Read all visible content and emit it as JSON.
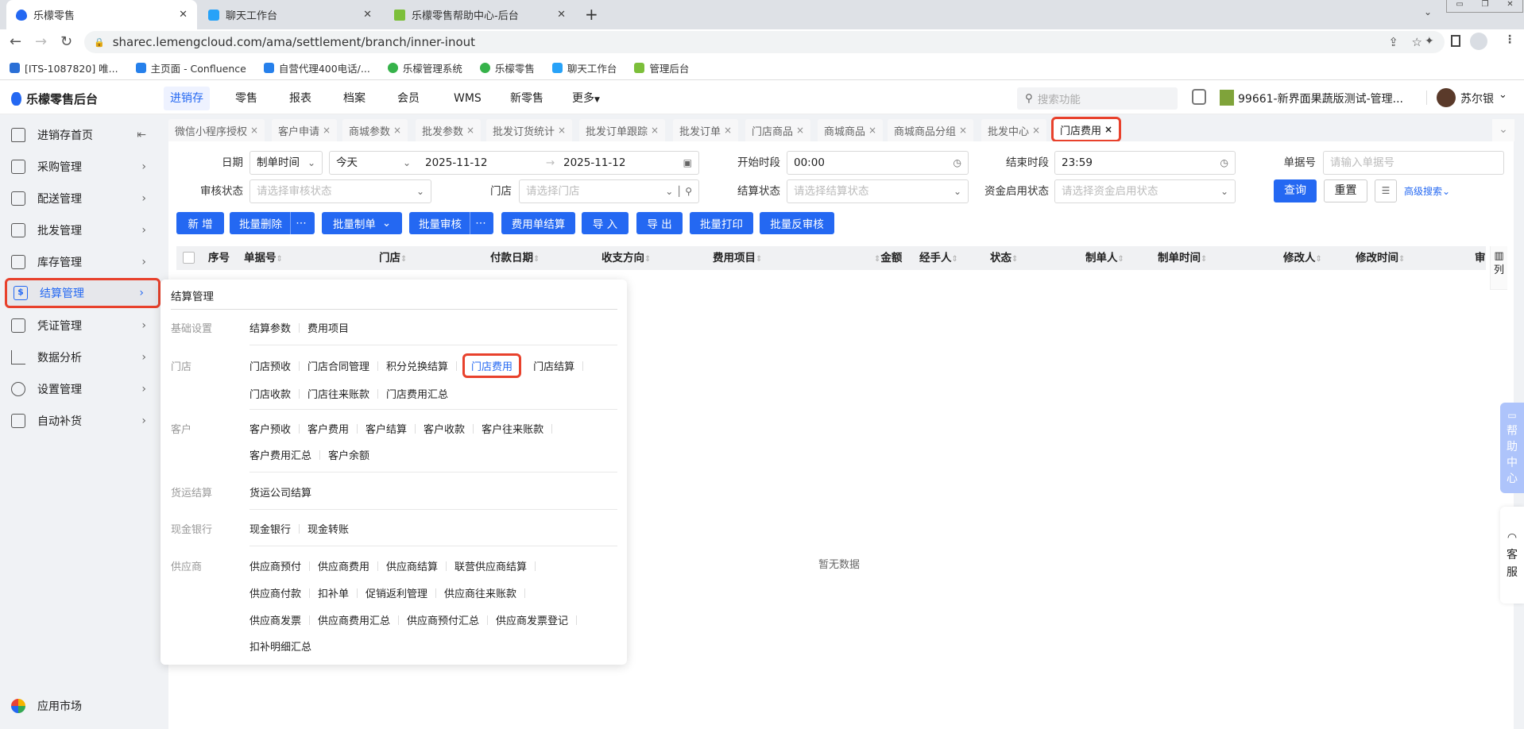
{
  "browser": {
    "tabs": [
      {
        "title": "乐檬零售",
        "active": true
      },
      {
        "title": "聊天工作台",
        "active": false
      },
      {
        "title": "乐檬零售帮助中心-后台",
        "active": false
      }
    ],
    "url": "sharec.lemengcloud.com/ama/settlement/branch/inner-inout",
    "bookmarks": [
      "[ITS-1087820] 唯...",
      "主页面 - Confluence",
      "自营代理400电话/...",
      "乐檬管理系统",
      "乐檬零售",
      "聊天工作台",
      "管理后台"
    ]
  },
  "header": {
    "logo": "乐檬零售后台",
    "nav": [
      "进销存",
      "零售",
      "报表",
      "档案",
      "会员",
      "WMS",
      "新零售",
      "更多"
    ],
    "search_placeholder": "搜索功能",
    "store": "99661-新界面果蔬版测试-管理...",
    "user": "苏尔银"
  },
  "sidebar": {
    "items": [
      "进销存首页",
      "采购管理",
      "配送管理",
      "批发管理",
      "库存管理",
      "结算管理",
      "凭证管理",
      "数据分析",
      "设置管理",
      "自动补货"
    ],
    "active": "结算管理",
    "footer": "应用市场"
  },
  "page_tabs": [
    "微信小程序授权",
    "客户申请",
    "商城参数",
    "批发参数",
    "批发订货统计",
    "批发订单跟踪",
    "批发订单",
    "门店商品",
    "商城商品",
    "商城商品分组",
    "批发中心",
    "门店费用"
  ],
  "filters": {
    "date_label": "日期",
    "date_type": "制单时间",
    "date_range": "今天",
    "date_start": "2025-11-12",
    "date_end": "2025-11-12",
    "start_time_label": "开始时段",
    "start_time": "00:00",
    "end_time_label": "结束时段",
    "end_time": "23:59",
    "doc_no_label": "单据号",
    "doc_no_placeholder": "请输入单据号",
    "audit_label": "审核状态",
    "audit_placeholder": "请选择审核状态",
    "store_label": "门店",
    "store_placeholder": "请选择门店",
    "settle_label": "结算状态",
    "settle_placeholder": "请选择结算状态",
    "fund_label": "资金启用状态",
    "fund_placeholder": "请选择资金启用状态",
    "query": "查询",
    "reset": "重置",
    "advanced": "高级搜索"
  },
  "actions": [
    "新 增",
    "批量删除",
    "批量制单",
    "批量审核",
    "费用单结算",
    "导 入",
    "导 出",
    "批量打印",
    "批量反审核"
  ],
  "table": {
    "columns": [
      "序号",
      "单据号",
      "门店",
      "付款日期",
      "收支方向",
      "费用项目",
      "金额",
      "经手人",
      "状态",
      "制单人",
      "制单时间",
      "修改人",
      "修改时间",
      "审"
    ],
    "column_setting": "列",
    "empty": "暂无数据"
  },
  "menu": {
    "title": "结算管理",
    "groups": [
      {
        "label": "基础设置",
        "rows": [
          [
            "结算参数",
            "费用项目"
          ]
        ]
      },
      {
        "label": "门店",
        "rows": [
          [
            "门店预收",
            "门店合同管理",
            "积分兑换结算",
            "门店费用",
            "门店结算"
          ],
          [
            "门店收款",
            "门店往来账款",
            "门店费用汇总"
          ]
        ]
      },
      {
        "label": "客户",
        "rows": [
          [
            "客户预收",
            "客户费用",
            "客户结算",
            "客户收款",
            "客户往来账款"
          ],
          [
            "客户费用汇总",
            "客户余额"
          ]
        ]
      },
      {
        "label": "货运结算",
        "rows": [
          [
            "货运公司结算"
          ]
        ]
      },
      {
        "label": "现金银行",
        "rows": [
          [
            "现金银行",
            "现金转账"
          ]
        ]
      },
      {
        "label": "供应商",
        "rows": [
          [
            "供应商预付",
            "供应商费用",
            "供应商结算",
            "联营供应商结算"
          ],
          [
            "供应商付款",
            "扣补单",
            "促销返利管理",
            "供应商往来账款"
          ],
          [
            "供应商发票",
            "供应商费用汇总",
            "供应商预付汇总",
            "供应商发票登记"
          ],
          [
            "扣补明细汇总"
          ]
        ]
      }
    ],
    "active_item": "门店费用"
  },
  "float": {
    "help": "帮助中心",
    "service": "客服"
  },
  "colors": {
    "primary": "#2468f2",
    "highlight": "#e8412c",
    "sidebar_bg": "#f0f2f5"
  }
}
